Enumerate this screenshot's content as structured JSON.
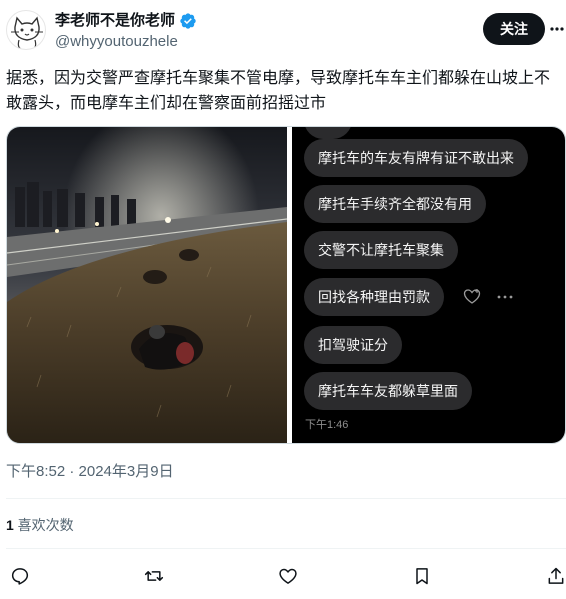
{
  "author": {
    "name": "李老师不是你老师",
    "handle": "@whyyoutouzhele",
    "verified_icon": "verified-badge-icon"
  },
  "header": {
    "follow_label": "关注",
    "more_icon": "more-options-icon"
  },
  "tweet": {
    "text": "据悉，因为交警严查摩托车聚集不管电摩，导致摩托车车主们都躲在山坡上不敢露头，而电摩车主们却在警察面前招摇过市"
  },
  "media": {
    "chat_messages": [
      "摩托车的车友有牌有证不敢出来",
      "摩托车手续齐全都没有用",
      "交警不让摩托车聚集",
      "回找各种理由罚款",
      "扣驾驶证分",
      "摩托车车友都躲草里面"
    ],
    "chat_time": "下午1:46"
  },
  "meta": {
    "timestamp": "下午8:52 · 2024年3月9日",
    "likes_count": "1",
    "likes_label": " 喜欢次数"
  },
  "actions": [
    "reply-icon",
    "retweet-icon",
    "like-icon",
    "bookmark-icon",
    "share-icon"
  ],
  "colors": {
    "text": "#0f1419",
    "secondary": "#536471",
    "verified": "#1d9bf0",
    "follow_bg": "#0f1419"
  }
}
